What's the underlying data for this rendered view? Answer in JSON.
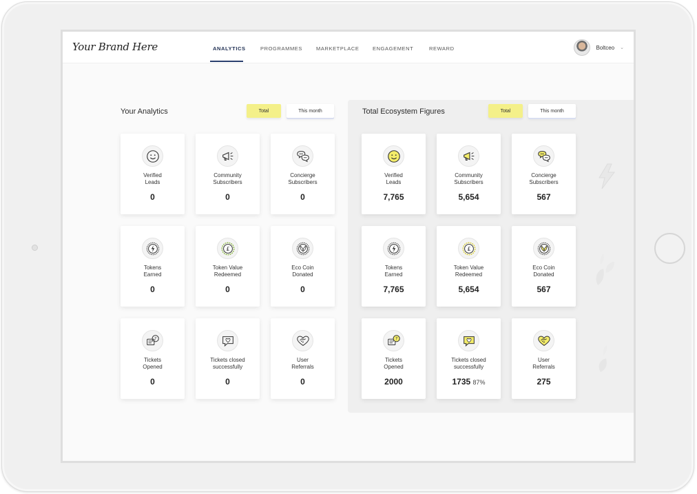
{
  "header": {
    "brand": "Your Brand Here",
    "nav": [
      "ANALYTICS",
      "PROGRAMMES",
      "MARKETPLACE",
      "ENGAGEMENT",
      "REWARD"
    ],
    "active_nav": "ANALYTICS",
    "user_name": "Boltceo",
    "chevron": "⌄"
  },
  "your_analytics": {
    "title": "Your Analytics",
    "toggle_total": "Total",
    "toggle_month": "This month",
    "cards": [
      {
        "label": "Verified\nLeads",
        "value": "0",
        "icon": "smiley-icon"
      },
      {
        "label": "Community\nSubscribers",
        "value": "0",
        "icon": "megaphone-icon"
      },
      {
        "label": "Concierge\nSubscribers",
        "value": "0",
        "icon": "chat-bubbles-icon"
      },
      {
        "label": "Tokens\nEarned",
        "value": "0",
        "icon": "lightning-coin-icon"
      },
      {
        "label": "Token Value\nRedeemed",
        "value": "0",
        "icon": "pound-coin-icon"
      },
      {
        "label": "Eco Coin\nDonated",
        "value": "0",
        "icon": "leaf-coin-icon"
      },
      {
        "label": "Tickets\nOpened",
        "value": "0",
        "icon": "ticket-question-icon"
      },
      {
        "label": "Tickets closed\nsuccessfully",
        "value": "0",
        "icon": "heart-chat-icon"
      },
      {
        "label": "User\nReferrals",
        "value": "0",
        "icon": "handshake-icon"
      }
    ]
  },
  "ecosystem": {
    "title": "Total Ecosystem Figures",
    "toggle_total": "Total",
    "toggle_month": "This month",
    "cards": [
      {
        "label": "Verified\nLeads",
        "value": "7,765",
        "icon": "smiley-icon"
      },
      {
        "label": "Community\nSubscribers",
        "value": "5,654",
        "icon": "megaphone-icon"
      },
      {
        "label": "Concierge\nSubscribers",
        "value": "567",
        "icon": "chat-bubbles-icon"
      },
      {
        "label": "Tokens\nEarned",
        "value": "7,765",
        "icon": "lightning-coin-icon"
      },
      {
        "label": "Token Value\nRedeemed",
        "value": "5,654",
        "icon": "pound-coin-icon"
      },
      {
        "label": "Eco Coin\nDonated",
        "value": "567",
        "icon": "leaf-coin-icon"
      },
      {
        "label": "Tickets\nOpened",
        "value": "2000",
        "icon": "ticket-question-icon"
      },
      {
        "label": "Tickets closed\nsuccessfully",
        "value": "1735",
        "percent": "87%",
        "icon": "heart-chat-icon"
      },
      {
        "label": "User\nReferrals",
        "value": "275",
        "icon": "handshake-icon"
      }
    ]
  },
  "colors": {
    "accent_yellow": "#f4f089",
    "nav_active": "#2a3f6e",
    "card_bg": "#ffffff",
    "panel_bg": "#efefef"
  }
}
